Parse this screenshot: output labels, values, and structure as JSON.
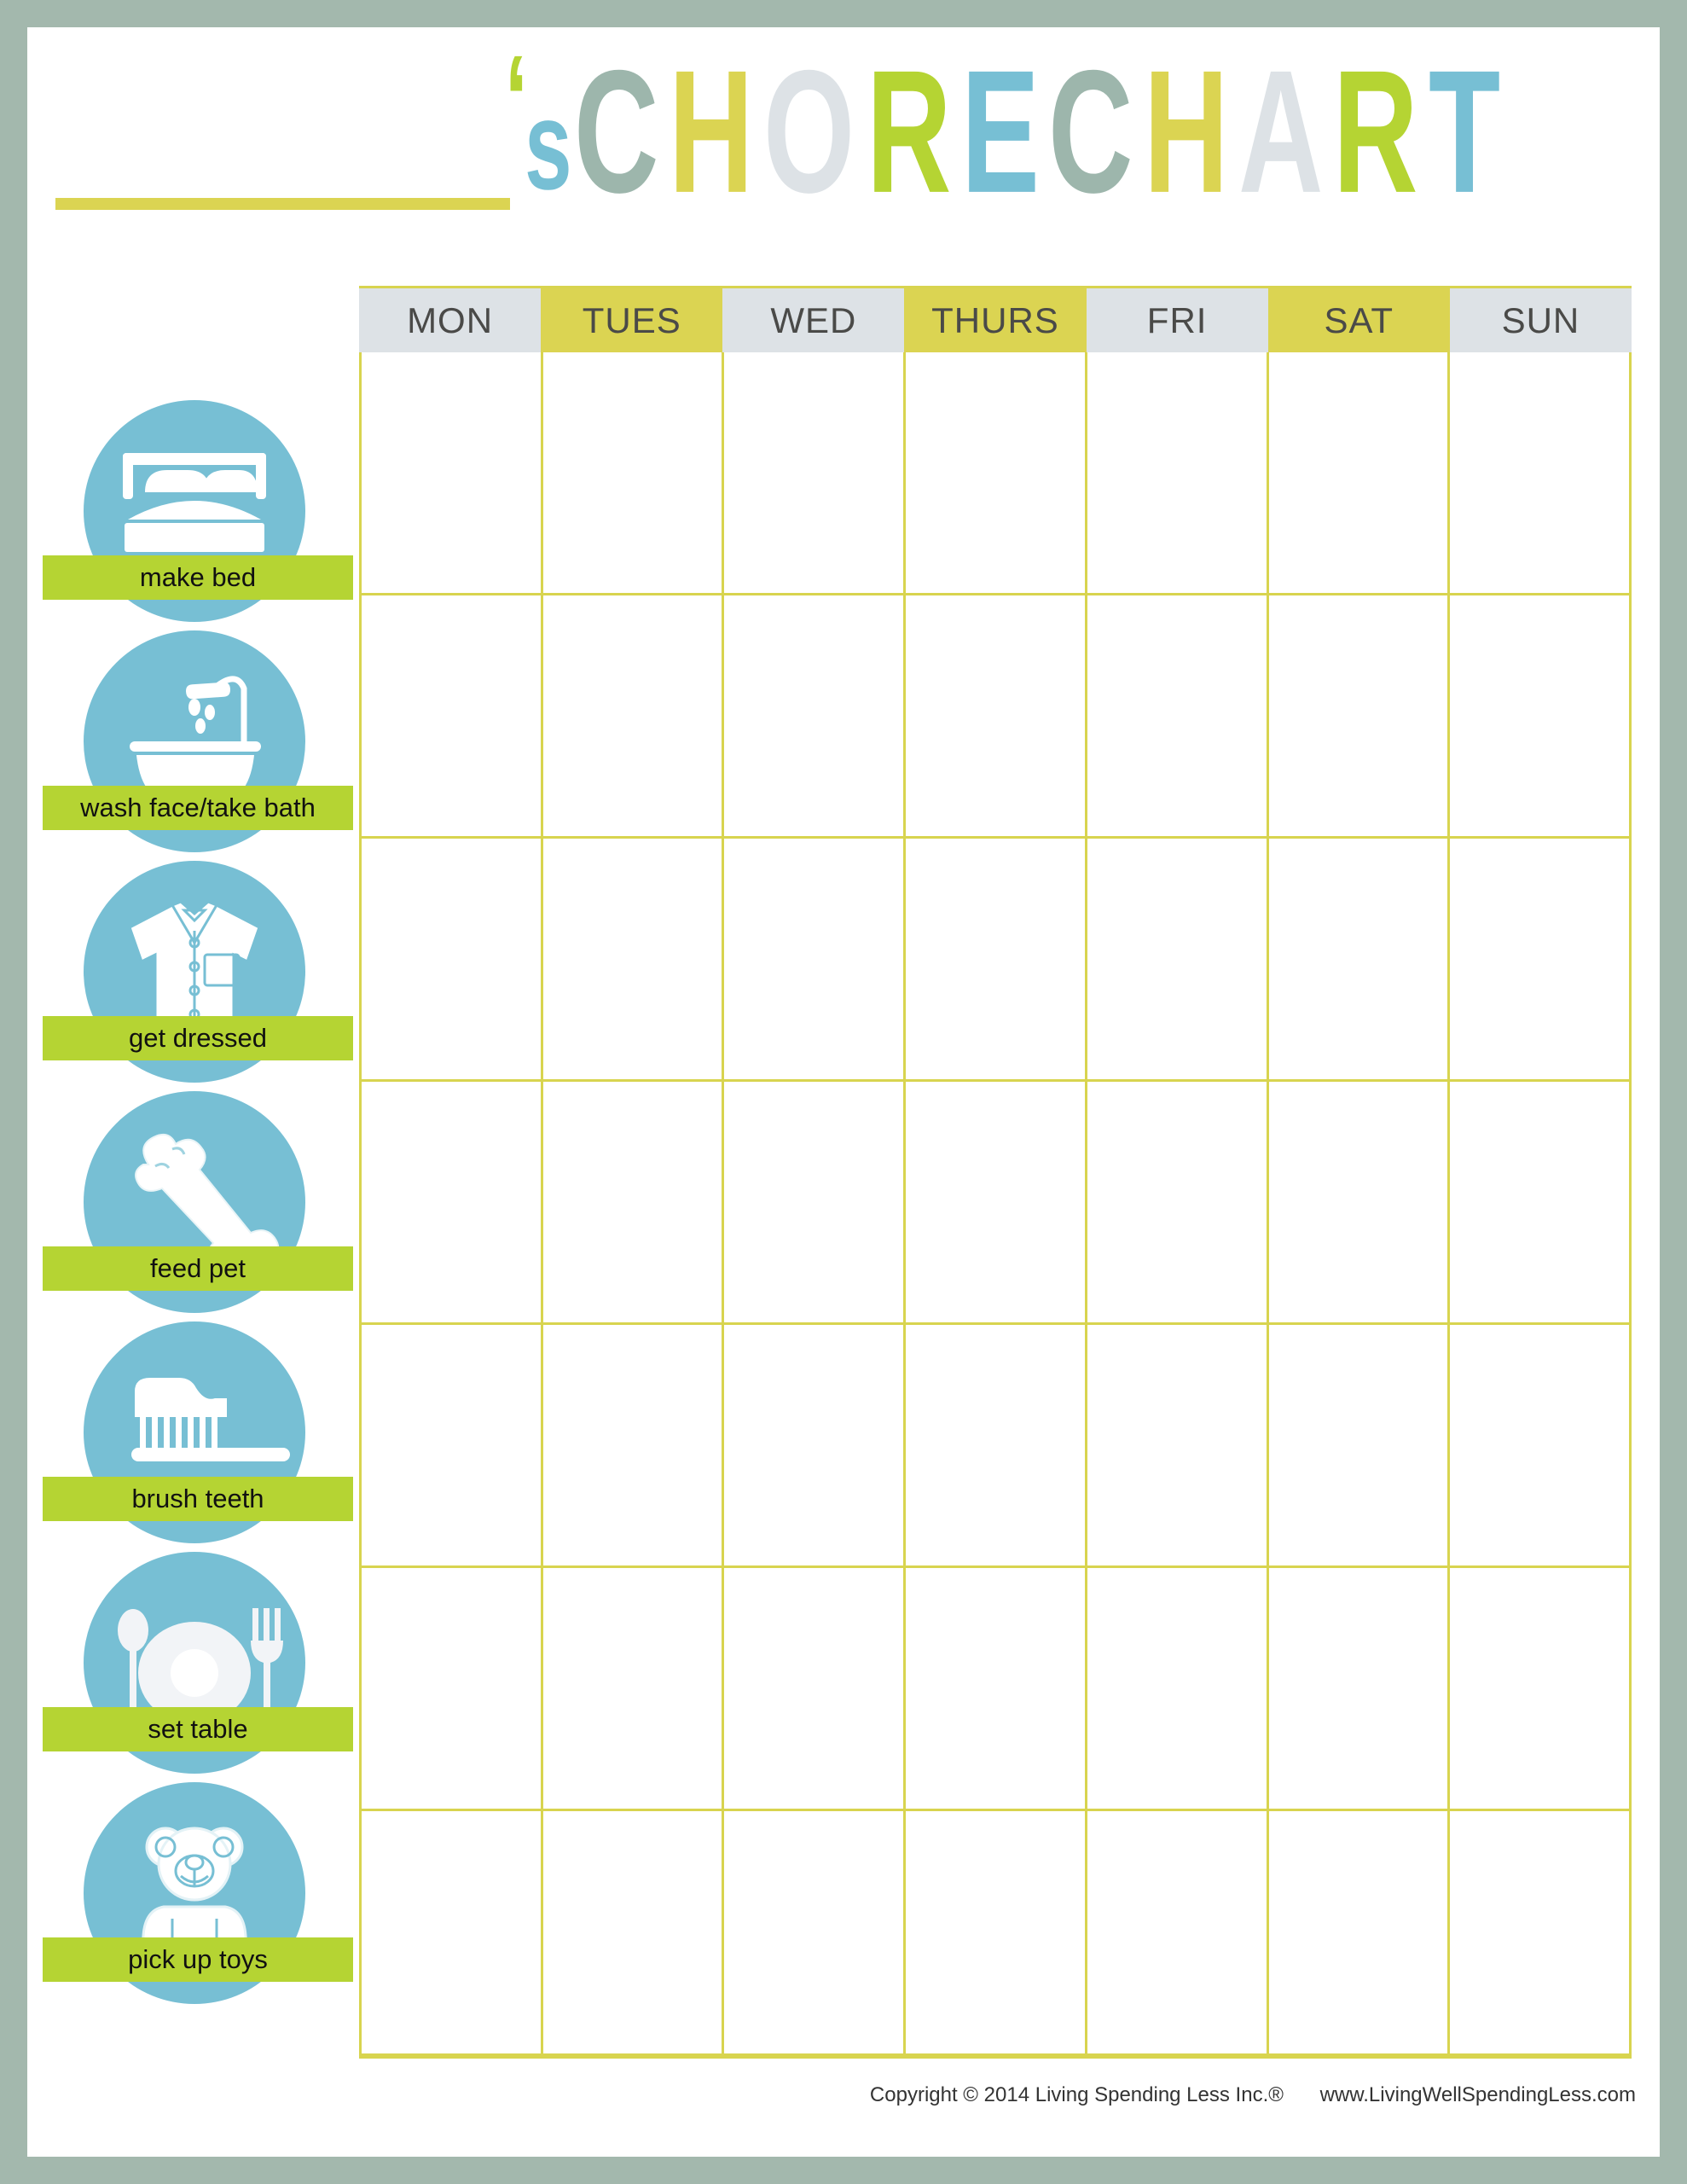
{
  "page": {
    "frame_color": "#a3b8ad",
    "sheet_color": "#ffffff"
  },
  "header": {
    "name_blank_label": "",
    "title_full": "'s CHORE CHART",
    "title_letters": [
      {
        "char": "‘",
        "color": "#b5d433",
        "class": "ti-apos"
      },
      {
        "char": "s",
        "color": "#77bfd4",
        "class": "ti-s"
      },
      {
        "char": "C",
        "color": "#9db6ac",
        "class": "ti-sage"
      },
      {
        "char": "H",
        "color": "#dbd452",
        "class": "ti-yellow"
      },
      {
        "char": "O",
        "color": "#dde2e6",
        "class": "ti-gray"
      },
      {
        "char": "R",
        "color": "#b5d433",
        "class": "ti-green"
      },
      {
        "char": "E",
        "color": "#77bfd4",
        "class": "ti-teal"
      },
      {
        "char": "C",
        "color": "#9db6ac",
        "class": "ti-sage"
      },
      {
        "char": "H",
        "color": "#dbd452",
        "class": "ti-yellow"
      },
      {
        "char": "A",
        "color": "#dde2e6",
        "class": "ti-gray"
      },
      {
        "char": "R",
        "color": "#b5d433",
        "class": "ti-green"
      },
      {
        "char": "T",
        "color": "#77bfd4",
        "class": "ti-teal"
      }
    ]
  },
  "table": {
    "days": [
      {
        "label": "MON",
        "bg": "#dde2e6",
        "style": "gray"
      },
      {
        "label": "TUES",
        "bg": "#dbd452",
        "style": "yellow"
      },
      {
        "label": "WED",
        "bg": "#dde2e6",
        "style": "gray"
      },
      {
        "label": "THURS",
        "bg": "#dbd452",
        "style": "yellow"
      },
      {
        "label": "FRI",
        "bg": "#dde2e6",
        "style": "gray"
      },
      {
        "label": "SAT",
        "bg": "#dbd452",
        "style": "yellow"
      },
      {
        "label": "SUN",
        "bg": "#dde2e6",
        "style": "gray"
      }
    ],
    "grid_line_color": "#d8d44f",
    "rows": 7,
    "columns": 7,
    "cells": [
      [
        "",
        "",
        "",
        "",
        "",
        "",
        ""
      ],
      [
        "",
        "",
        "",
        "",
        "",
        "",
        ""
      ],
      [
        "",
        "",
        "",
        "",
        "",
        "",
        ""
      ],
      [
        "",
        "",
        "",
        "",
        "",
        "",
        ""
      ],
      [
        "",
        "",
        "",
        "",
        "",
        "",
        ""
      ],
      [
        "",
        "",
        "",
        "",
        "",
        "",
        ""
      ],
      [
        "",
        "",
        "",
        "",
        "",
        "",
        ""
      ]
    ]
  },
  "chores": {
    "circle_color": "#77bfd4",
    "label_bar_color": "#b5d433",
    "items": [
      {
        "label": "make bed",
        "icon": "bed-icon"
      },
      {
        "label": "wash face/take bath",
        "icon": "bathtub-icon"
      },
      {
        "label": "get dressed",
        "icon": "shirt-icon"
      },
      {
        "label": "feed pet",
        "icon": "bone-icon"
      },
      {
        "label": "brush teeth",
        "icon": "toothbrush-icon"
      },
      {
        "label": "set table",
        "icon": "place-setting-icon"
      },
      {
        "label": "pick up toys",
        "icon": "teddy-bear-icon"
      }
    ]
  },
  "footer": {
    "copyright": "Copyright © 2014 Living Spending Less Inc.®",
    "website": "www.LivingWellSpendingLess.com"
  }
}
